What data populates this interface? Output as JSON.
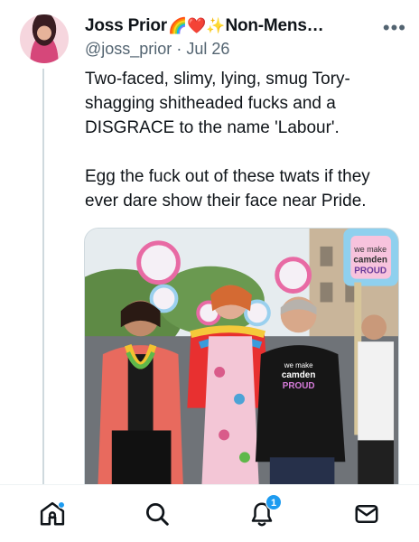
{
  "tweet": {
    "display_name": "Joss Prior",
    "name_emoji": "🌈❤️✨",
    "name_suffix": "Non-Mens…",
    "handle": "@joss_prior",
    "separator": "·",
    "date": "Jul 26",
    "more_label": "•••",
    "paragraphs": [
      "Two-faced, slimy, lying, smug Tory-shagging shitheaded fucks and a DISGRACE to the name 'Labour'.",
      "Egg the fuck out of these twats if they ever dare show their face near Pride."
    ],
    "media": {
      "sign_text": "we make camden PROUD",
      "tshirt_text": "we make camden PROUD"
    }
  },
  "nav": {
    "items": [
      "home-icon",
      "search-icon",
      "notifications-icon",
      "messages-icon"
    ],
    "notifications_badge": "1",
    "home_has_dot": true,
    "accent": "#1d9bf0"
  }
}
